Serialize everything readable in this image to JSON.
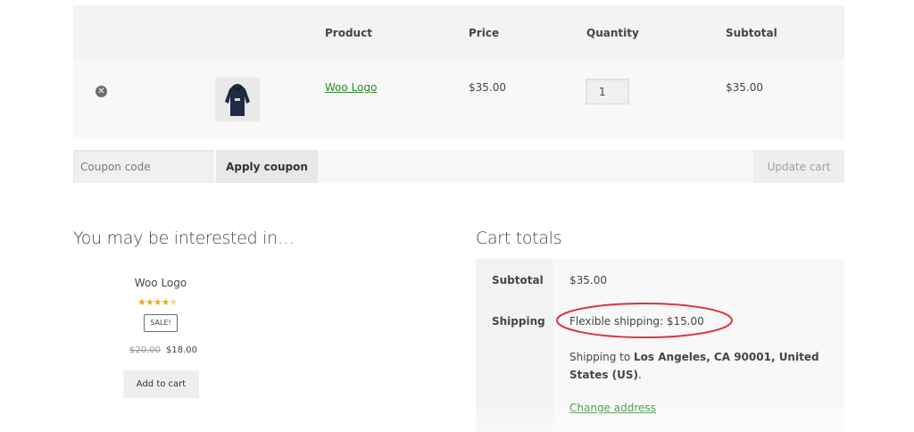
{
  "cart": {
    "headers": {
      "product": "Product",
      "price": "Price",
      "quantity": "Quantity",
      "subtotal": "Subtotal"
    },
    "row": {
      "remove_icon": "remove-icon",
      "product_name": "Woo Logo",
      "price": "$35.00",
      "quantity": "1",
      "subtotal": "$35.00"
    }
  },
  "actions": {
    "coupon_placeholder": "Coupon code",
    "apply_label": "Apply coupon",
    "update_label": "Update cart"
  },
  "related": {
    "title": "You may be interested in…",
    "product": {
      "name": "Woo Logo",
      "rating": 4,
      "rating_max": 5,
      "badge": "SALE!",
      "old_price": "$20.00",
      "new_price": "$18.00",
      "button": "Add to cart"
    }
  },
  "totals": {
    "title": "Cart totals",
    "subtotal_label": "Subtotal",
    "subtotal_value": "$35.00",
    "shipping_label": "Shipping",
    "shipping_method": "Flexible shipping: $15.00",
    "shipping_to_prefix": "Shipping to ",
    "shipping_to_location": "Los Angeles, CA 90001, United States (US)",
    "shipping_to_suffix": ".",
    "change_address": "Change address"
  },
  "colors": {
    "link": "#2c8a2c",
    "star": "#f0ad00",
    "annotation": "#d9363e"
  }
}
